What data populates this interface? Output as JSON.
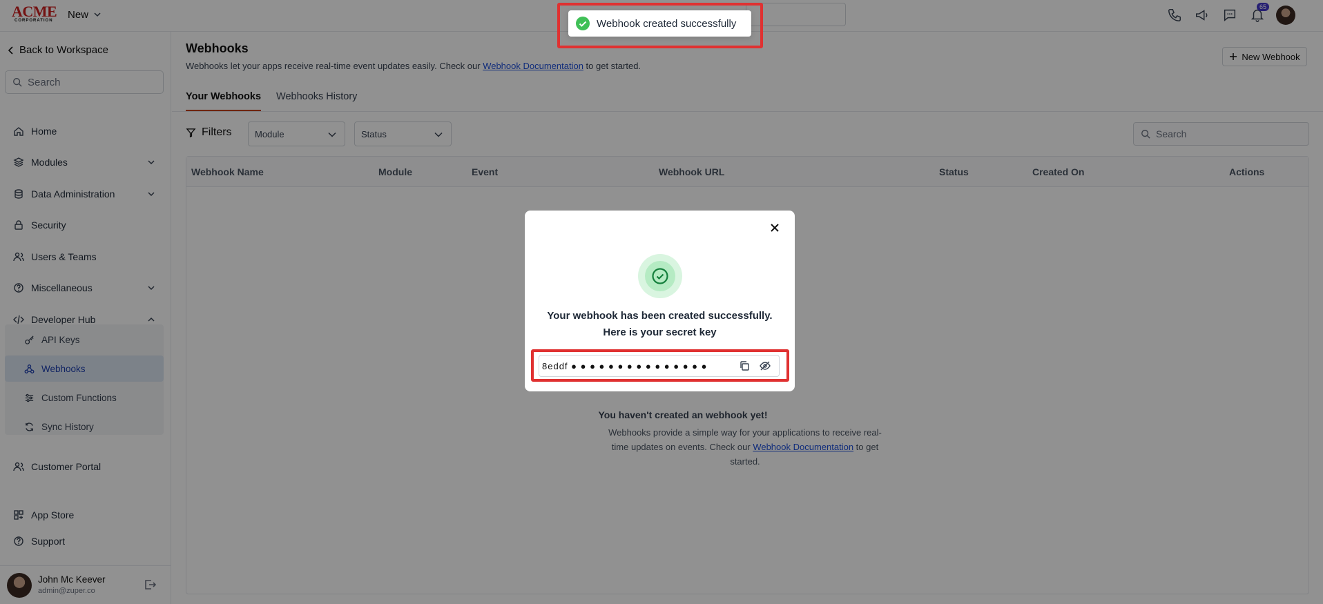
{
  "topbar": {
    "logo_text": "ACME",
    "logo_subtext": "CORPORATION",
    "new_label": "New",
    "notification_count": "65"
  },
  "sidebar": {
    "back_label": "Back to Workspace",
    "search_placeholder": "Search",
    "items": [
      {
        "label": "Home"
      },
      {
        "label": "Modules"
      },
      {
        "label": "Data Administration"
      },
      {
        "label": "Security"
      },
      {
        "label": "Users & Teams"
      },
      {
        "label": "Miscellaneous"
      },
      {
        "label": "Developer Hub"
      }
    ],
    "subitems": [
      {
        "label": "API Keys"
      },
      {
        "label": "Webhooks"
      },
      {
        "label": "Custom Functions"
      },
      {
        "label": "Sync History"
      }
    ],
    "bottom_items": [
      {
        "label": "Customer Portal"
      },
      {
        "label": "App Store"
      },
      {
        "label": "Support"
      }
    ],
    "user": {
      "name": "John Mc Keever",
      "email": "admin@zuper.co"
    }
  },
  "page": {
    "title": "Webhooks",
    "desc_before": "Webhooks let your apps receive real-time event updates easily. Check our ",
    "desc_link": "Webhook Documentation",
    "desc_after": " to get started.",
    "new_button": "New Webhook",
    "tabs": [
      {
        "label": "Your Webhooks",
        "active": true
      },
      {
        "label": "Webhooks History",
        "active": false
      }
    ],
    "filters_label": "Filters",
    "module_select": "Module",
    "status_select": "Status",
    "search_placeholder": "Search",
    "columns": [
      "Webhook Name",
      "Module",
      "Event",
      "Webhook URL",
      "Status",
      "Created On",
      "Actions"
    ],
    "empty_title": "You haven't created an webhook yet!",
    "empty_desc_before": "Webhooks provide a simple way for your applications to receive real-time updates on events. Check our ",
    "empty_desc_link": "Webhook Documentation",
    "empty_desc_after": " to get started."
  },
  "toast": {
    "message": "Webhook created successfully"
  },
  "modal": {
    "line1": "Your webhook has been created successfully.",
    "line2": "Here is your secret key",
    "secret_key_display": "8eddf ● ● ● ● ● ● ● ● ● ● ● ● ● ● ● ● ● ● ●"
  },
  "colors": {
    "accent": "#c2410c",
    "link": "#1d4ed8",
    "success": "#16a34a",
    "highlight": "#e03131"
  }
}
